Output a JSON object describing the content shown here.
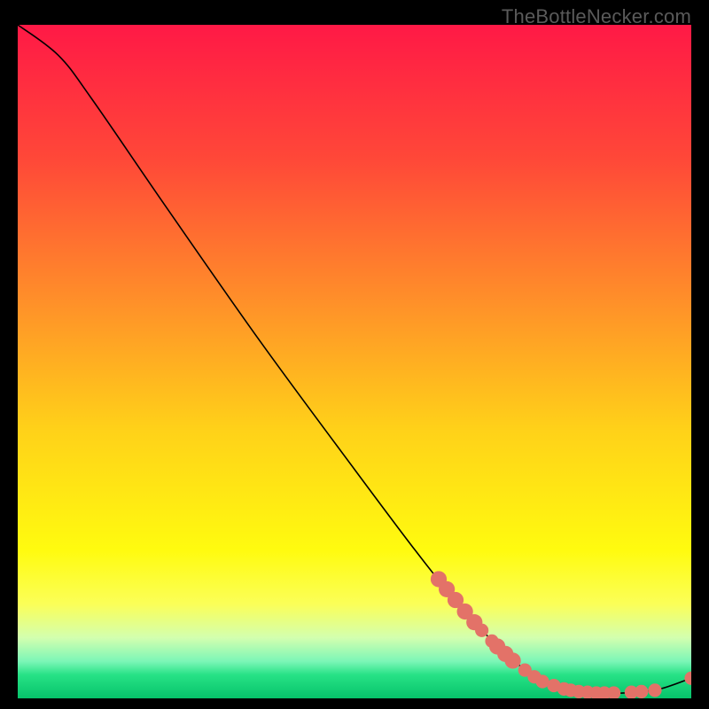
{
  "watermark": "TheBottleNecker.com",
  "chart_data": {
    "type": "line",
    "title": "",
    "xlabel": "",
    "ylabel": "",
    "xlim": [
      0,
      100
    ],
    "ylim": [
      0,
      100
    ],
    "note": "Axes unlabelled; values are relative 0..100 within the plot area. Curve descends from top-left to a flat bottom on the right; red marker dots cluster on the lower-right portion of the curve.",
    "curve": [
      {
        "x": 0,
        "y": 100
      },
      {
        "x": 6,
        "y": 95.5
      },
      {
        "x": 11,
        "y": 89
      },
      {
        "x": 22,
        "y": 73
      },
      {
        "x": 36,
        "y": 53
      },
      {
        "x": 50,
        "y": 34
      },
      {
        "x": 59,
        "y": 22
      },
      {
        "x": 65,
        "y": 14.5
      },
      {
        "x": 70,
        "y": 9
      },
      {
        "x": 75,
        "y": 4.5
      },
      {
        "x": 80,
        "y": 1.8
      },
      {
        "x": 85,
        "y": 0.8
      },
      {
        "x": 90,
        "y": 0.8
      },
      {
        "x": 95,
        "y": 1.3
      },
      {
        "x": 100,
        "y": 3.0
      }
    ],
    "markers": [
      {
        "x": 62.5,
        "y": 17.7,
        "r": 1.2
      },
      {
        "x": 63.7,
        "y": 16.2,
        "r": 1.2
      },
      {
        "x": 65.0,
        "y": 14.6,
        "r": 1.2
      },
      {
        "x": 66.4,
        "y": 12.9,
        "r": 1.2
      },
      {
        "x": 67.8,
        "y": 11.3,
        "r": 1.2
      },
      {
        "x": 68.9,
        "y": 10.1,
        "r": 1.0
      },
      {
        "x": 70.4,
        "y": 8.5,
        "r": 1.0
      },
      {
        "x": 71.2,
        "y": 7.7,
        "r": 1.2
      },
      {
        "x": 72.4,
        "y": 6.6,
        "r": 1.2
      },
      {
        "x": 73.5,
        "y": 5.6,
        "r": 1.2
      },
      {
        "x": 75.3,
        "y": 4.2,
        "r": 1.0
      },
      {
        "x": 76.7,
        "y": 3.2,
        "r": 1.0
      },
      {
        "x": 77.9,
        "y": 2.5,
        "r": 1.0
      },
      {
        "x": 79.6,
        "y": 1.9,
        "r": 1.0
      },
      {
        "x": 81.1,
        "y": 1.4,
        "r": 1.0
      },
      {
        "x": 82.1,
        "y": 1.2,
        "r": 1.0
      },
      {
        "x": 83.3,
        "y": 1.0,
        "r": 1.0
      },
      {
        "x": 84.6,
        "y": 0.9,
        "r": 1.0
      },
      {
        "x": 85.9,
        "y": 0.8,
        "r": 1.0
      },
      {
        "x": 87.1,
        "y": 0.8,
        "r": 1.0
      },
      {
        "x": 88.5,
        "y": 0.8,
        "r": 1.0
      },
      {
        "x": 91.1,
        "y": 0.9,
        "r": 1.0
      },
      {
        "x": 92.6,
        "y": 1.0,
        "r": 1.0
      },
      {
        "x": 94.6,
        "y": 1.2,
        "r": 1.0
      },
      {
        "x": 100.0,
        "y": 3.0,
        "r": 1.0
      }
    ],
    "marker_color": "#e37268",
    "curve_color": "#000000",
    "gradient_stops": [
      {
        "offset": 0.0,
        "color": "#ff1946"
      },
      {
        "offset": 0.2,
        "color": "#ff4838"
      },
      {
        "offset": 0.4,
        "color": "#ff8c2a"
      },
      {
        "offset": 0.6,
        "color": "#ffd119"
      },
      {
        "offset": 0.78,
        "color": "#fffb0f"
      },
      {
        "offset": 0.86,
        "color": "#fbff58"
      },
      {
        "offset": 0.91,
        "color": "#d3ffaf"
      },
      {
        "offset": 0.945,
        "color": "#7cf6b7"
      },
      {
        "offset": 0.965,
        "color": "#27e286"
      },
      {
        "offset": 1.0,
        "color": "#06c36a"
      }
    ]
  }
}
